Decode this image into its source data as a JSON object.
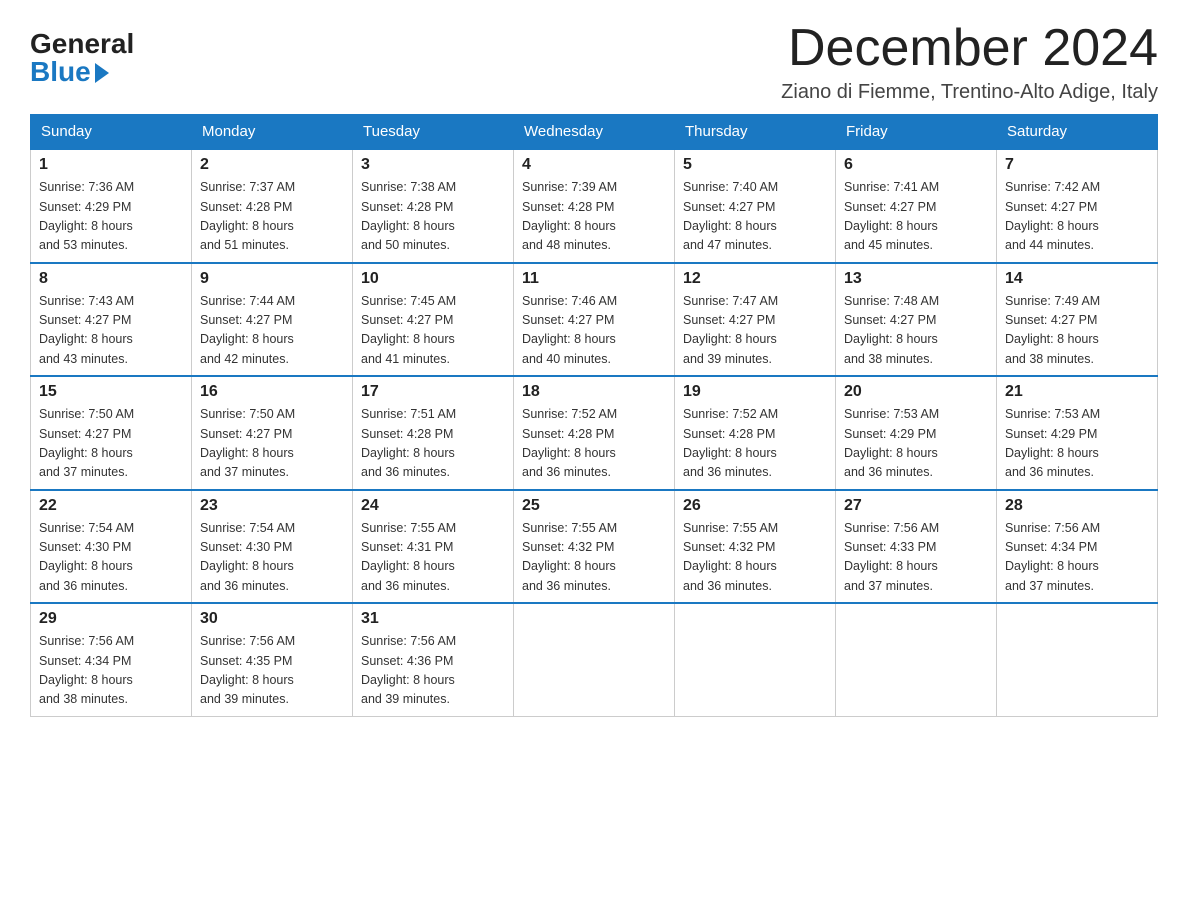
{
  "header": {
    "logo_general": "General",
    "logo_blue": "Blue",
    "month_title": "December 2024",
    "location": "Ziano di Fiemme, Trentino-Alto Adige, Italy"
  },
  "days_of_week": [
    "Sunday",
    "Monday",
    "Tuesday",
    "Wednesday",
    "Thursday",
    "Friday",
    "Saturday"
  ],
  "weeks": [
    [
      {
        "day": "1",
        "sunrise": "7:36 AM",
        "sunset": "4:29 PM",
        "daylight": "8 hours and 53 minutes."
      },
      {
        "day": "2",
        "sunrise": "7:37 AM",
        "sunset": "4:28 PM",
        "daylight": "8 hours and 51 minutes."
      },
      {
        "day": "3",
        "sunrise": "7:38 AM",
        "sunset": "4:28 PM",
        "daylight": "8 hours and 50 minutes."
      },
      {
        "day": "4",
        "sunrise": "7:39 AM",
        "sunset": "4:28 PM",
        "daylight": "8 hours and 48 minutes."
      },
      {
        "day": "5",
        "sunrise": "7:40 AM",
        "sunset": "4:27 PM",
        "daylight": "8 hours and 47 minutes."
      },
      {
        "day": "6",
        "sunrise": "7:41 AM",
        "sunset": "4:27 PM",
        "daylight": "8 hours and 45 minutes."
      },
      {
        "day": "7",
        "sunrise": "7:42 AM",
        "sunset": "4:27 PM",
        "daylight": "8 hours and 44 minutes."
      }
    ],
    [
      {
        "day": "8",
        "sunrise": "7:43 AM",
        "sunset": "4:27 PM",
        "daylight": "8 hours and 43 minutes."
      },
      {
        "day": "9",
        "sunrise": "7:44 AM",
        "sunset": "4:27 PM",
        "daylight": "8 hours and 42 minutes."
      },
      {
        "day": "10",
        "sunrise": "7:45 AM",
        "sunset": "4:27 PM",
        "daylight": "8 hours and 41 minutes."
      },
      {
        "day": "11",
        "sunrise": "7:46 AM",
        "sunset": "4:27 PM",
        "daylight": "8 hours and 40 minutes."
      },
      {
        "day": "12",
        "sunrise": "7:47 AM",
        "sunset": "4:27 PM",
        "daylight": "8 hours and 39 minutes."
      },
      {
        "day": "13",
        "sunrise": "7:48 AM",
        "sunset": "4:27 PM",
        "daylight": "8 hours and 38 minutes."
      },
      {
        "day": "14",
        "sunrise": "7:49 AM",
        "sunset": "4:27 PM",
        "daylight": "8 hours and 38 minutes."
      }
    ],
    [
      {
        "day": "15",
        "sunrise": "7:50 AM",
        "sunset": "4:27 PM",
        "daylight": "8 hours and 37 minutes."
      },
      {
        "day": "16",
        "sunrise": "7:50 AM",
        "sunset": "4:27 PM",
        "daylight": "8 hours and 37 minutes."
      },
      {
        "day": "17",
        "sunrise": "7:51 AM",
        "sunset": "4:28 PM",
        "daylight": "8 hours and 36 minutes."
      },
      {
        "day": "18",
        "sunrise": "7:52 AM",
        "sunset": "4:28 PM",
        "daylight": "8 hours and 36 minutes."
      },
      {
        "day": "19",
        "sunrise": "7:52 AM",
        "sunset": "4:28 PM",
        "daylight": "8 hours and 36 minutes."
      },
      {
        "day": "20",
        "sunrise": "7:53 AM",
        "sunset": "4:29 PM",
        "daylight": "8 hours and 36 minutes."
      },
      {
        "day": "21",
        "sunrise": "7:53 AM",
        "sunset": "4:29 PM",
        "daylight": "8 hours and 36 minutes."
      }
    ],
    [
      {
        "day": "22",
        "sunrise": "7:54 AM",
        "sunset": "4:30 PM",
        "daylight": "8 hours and 36 minutes."
      },
      {
        "day": "23",
        "sunrise": "7:54 AM",
        "sunset": "4:30 PM",
        "daylight": "8 hours and 36 minutes."
      },
      {
        "day": "24",
        "sunrise": "7:55 AM",
        "sunset": "4:31 PM",
        "daylight": "8 hours and 36 minutes."
      },
      {
        "day": "25",
        "sunrise": "7:55 AM",
        "sunset": "4:32 PM",
        "daylight": "8 hours and 36 minutes."
      },
      {
        "day": "26",
        "sunrise": "7:55 AM",
        "sunset": "4:32 PM",
        "daylight": "8 hours and 36 minutes."
      },
      {
        "day": "27",
        "sunrise": "7:56 AM",
        "sunset": "4:33 PM",
        "daylight": "8 hours and 37 minutes."
      },
      {
        "day": "28",
        "sunrise": "7:56 AM",
        "sunset": "4:34 PM",
        "daylight": "8 hours and 37 minutes."
      }
    ],
    [
      {
        "day": "29",
        "sunrise": "7:56 AM",
        "sunset": "4:34 PM",
        "daylight": "8 hours and 38 minutes."
      },
      {
        "day": "30",
        "sunrise": "7:56 AM",
        "sunset": "4:35 PM",
        "daylight": "8 hours and 39 minutes."
      },
      {
        "day": "31",
        "sunrise": "7:56 AM",
        "sunset": "4:36 PM",
        "daylight": "8 hours and 39 minutes."
      },
      null,
      null,
      null,
      null
    ]
  ],
  "labels": {
    "sunrise": "Sunrise:",
    "sunset": "Sunset:",
    "daylight": "Daylight:"
  }
}
